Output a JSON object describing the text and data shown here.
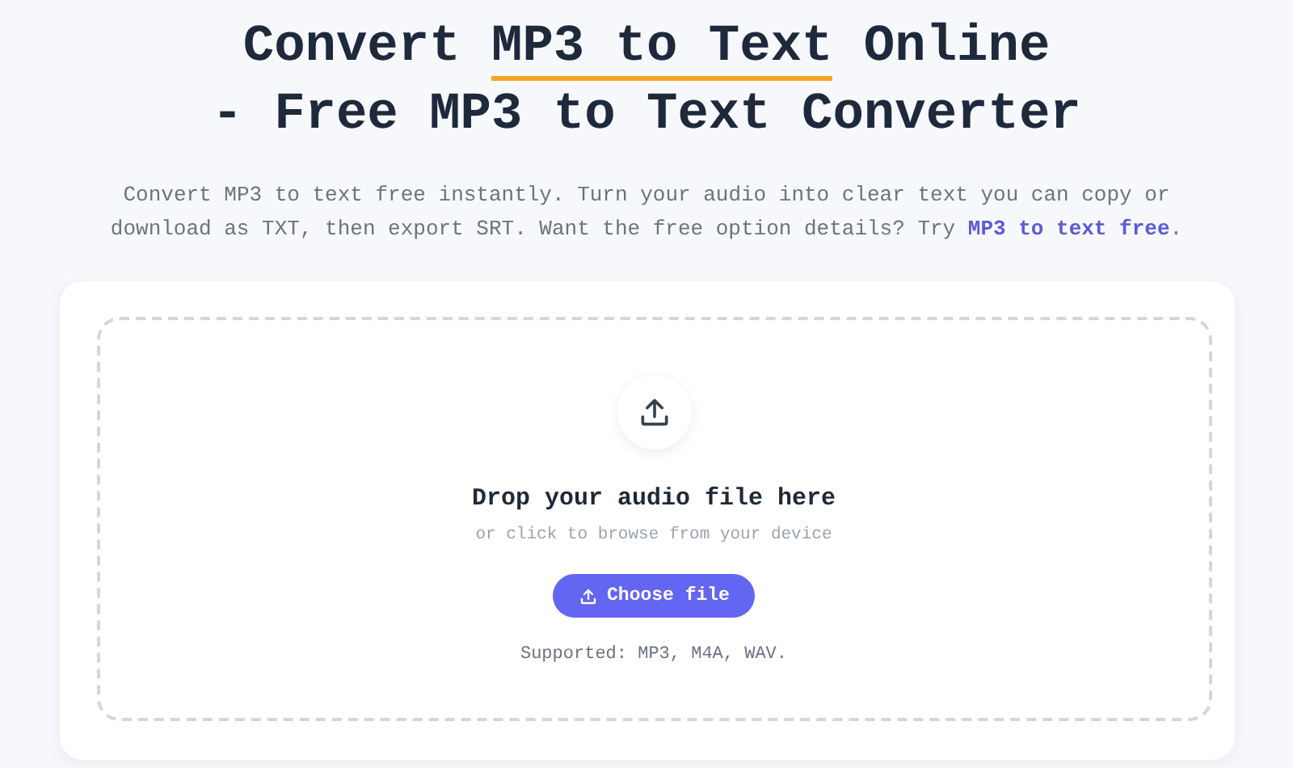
{
  "heading": {
    "before": "Convert ",
    "highlight": "MP3 to Text",
    "after": " Online",
    "line_2": "- Free MP3 to Text Converter"
  },
  "intro": {
    "text": "Convert MP3 to text free instantly. Turn your audio into clear text you can copy or download as TXT, then export SRT. Want the free option details? Try ",
    "link": "MP3 to text free",
    "end": "."
  },
  "dropzone": {
    "title": "Drop your audio file here",
    "subtitle": "or click to browse from your device",
    "button": "Choose file",
    "supported": "Supported: MP3, M4A, WAV."
  }
}
